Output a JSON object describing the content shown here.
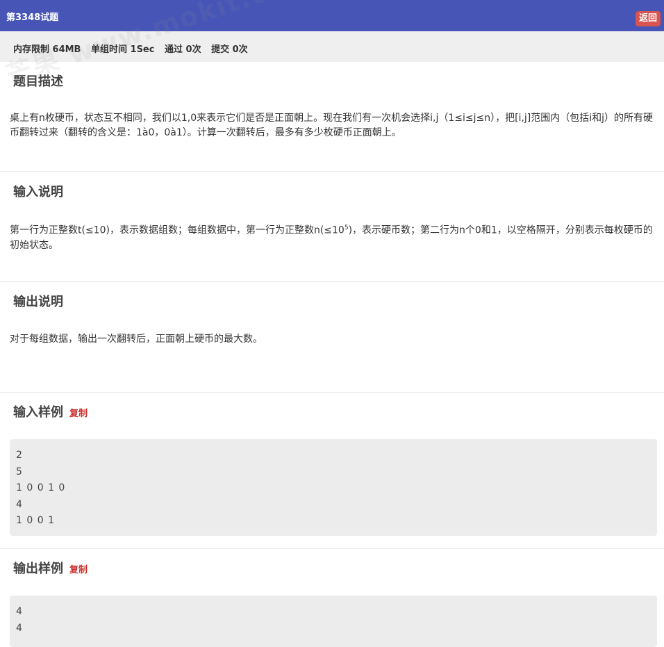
{
  "header": {
    "title": "第3348试题",
    "back_label": "返回"
  },
  "limits": {
    "memory": "内存限制 64MB",
    "time": "单组时间 1Sec",
    "passed": "通过 0次",
    "submitted": "提交 0次"
  },
  "watermark": "芒果 www.mokit.top",
  "description": {
    "title": "题目描述",
    "text": "桌上有n枚硬币，状态互不相同，我们以1,0来表示它们是否是正面朝上。现在我们有一次机会选择i,j（1≤i≤j≤n），把[i,j]范围内（包括i和j）的所有硬币翻转过来（翻转的含义是：1à0，0à1）。计算一次翻转后，最多有多少枚硬币正面朝上。"
  },
  "input_desc": {
    "title": "输入说明",
    "text_before": "第一行为正整数t(≤10)，表示数据组数；每组数据中，第一行为正整数n(≤10",
    "sup": "5",
    "text_after": ")，表示硬币数；第二行为n个0和1，以空格隔开，分别表示每枚硬币的初始状态。"
  },
  "output_desc": {
    "title": "输出说明",
    "text": "对于每组数据，输出一次翻转后，正面朝上硬币的最大数。"
  },
  "sample_input": {
    "title": "输入样例",
    "copy_label": "复制",
    "lines": [
      "2",
      "5",
      "1 0 0 1 0",
      "4",
      "1 0 0 1"
    ]
  },
  "sample_output": {
    "title": "输出样例",
    "copy_label": "复制",
    "lines": [
      "4",
      "4"
    ]
  }
}
